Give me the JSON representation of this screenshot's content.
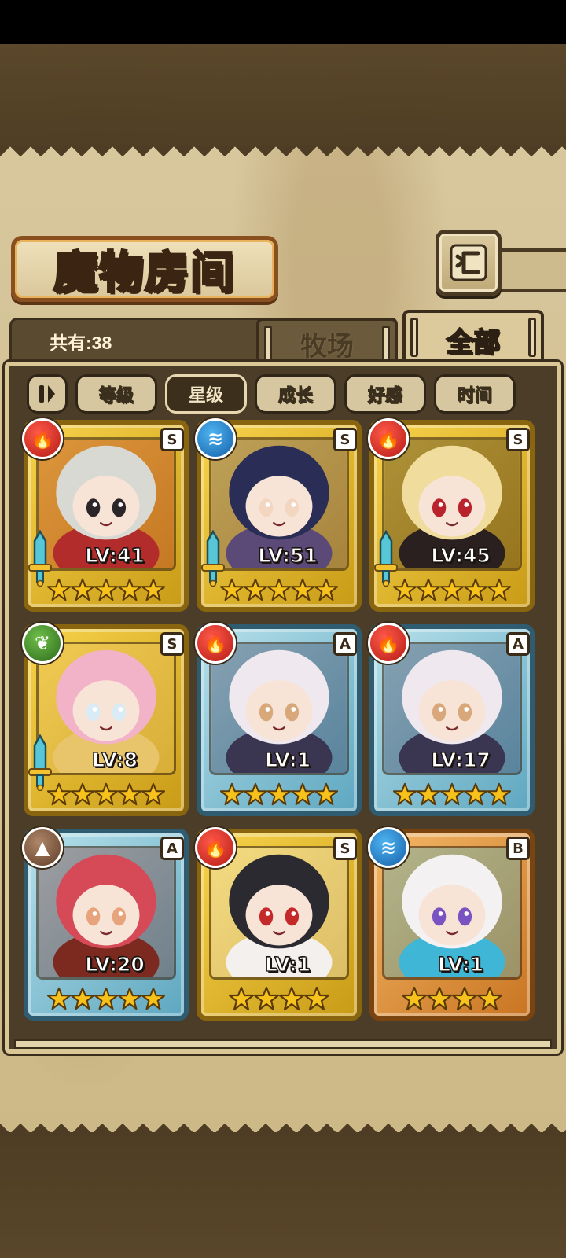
{
  "screen": {
    "title": "魔物房间",
    "count_text": "共有:38",
    "tabs": [
      {
        "label": "牧场",
        "active": false
      },
      {
        "label": "全部",
        "active": true
      }
    ],
    "sort_buttons": [
      {
        "label": "等级",
        "active": false
      },
      {
        "label": "星级",
        "active": true
      },
      {
        "label": "成长",
        "active": false
      },
      {
        "label": "好感",
        "active": false
      },
      {
        "label": "时间",
        "active": false
      }
    ]
  },
  "monsters": [
    {
      "level": "LV:41",
      "rank": "S",
      "element": "fire",
      "stars": 5,
      "weapon": true,
      "palette": [
        "#d9d9d4",
        "#2b2428",
        "#b22c2c"
      ]
    },
    {
      "level": "LV:51",
      "rank": "S",
      "element": "water",
      "stars": 5,
      "weapon": true,
      "palette": [
        "#2a2d55",
        "#f3d6c0",
        "#5b4a78"
      ]
    },
    {
      "level": "LV:45",
      "rank": "S",
      "element": "fire",
      "stars": 5,
      "weapon": true,
      "palette": [
        "#f0dc9c",
        "#b8232c",
        "#2a2020"
      ]
    },
    {
      "level": "LV:8",
      "rank": "S",
      "element": "nature",
      "stars": 5,
      "weapon": true,
      "palette": [
        "#f2b2c8",
        "#d9ecf5",
        "#e8c46a"
      ]
    },
    {
      "level": "LV:1",
      "rank": "A",
      "element": "fire",
      "stars": 5,
      "weapon": false,
      "palette": [
        "#efe8ee",
        "#d8a77a",
        "#3a3550"
      ]
    },
    {
      "level": "LV:17",
      "rank": "A",
      "element": "fire",
      "stars": 5,
      "weapon": false,
      "palette": [
        "#efe8ee",
        "#d8a77a",
        "#3a3550"
      ]
    },
    {
      "level": "LV:20",
      "rank": "A",
      "element": "earth",
      "stars": 5,
      "weapon": false,
      "palette": [
        "#d64a58",
        "#e7a47c",
        "#7c2a1f"
      ]
    },
    {
      "level": "LV:1",
      "rank": "S",
      "element": "fire",
      "stars": 4,
      "weapon": false,
      "palette": [
        "#2a2a30",
        "#c42a2a",
        "#f3f0ee"
      ]
    },
    {
      "level": "LV:1",
      "rank": "B",
      "element": "water",
      "stars": 4,
      "weapon": false,
      "palette": [
        "#f4f1f2",
        "#7b52c2",
        "#3fb6d6"
      ]
    }
  ],
  "icons": {
    "back": "return-arrow-icon",
    "sort_toggle": "sort-toggle-icon",
    "star": "star-icon",
    "weapon": "sword-icon",
    "elements": {
      "fire": "fire-icon",
      "water": "water-icon",
      "nature": "leaf-icon",
      "earth": "mountain-icon"
    }
  },
  "colors": {
    "accent_brown": "#8a4f1f",
    "parchment": "#d8c79d",
    "panel_bg": "#4b3d28",
    "star_gold": "#f6c21b"
  }
}
